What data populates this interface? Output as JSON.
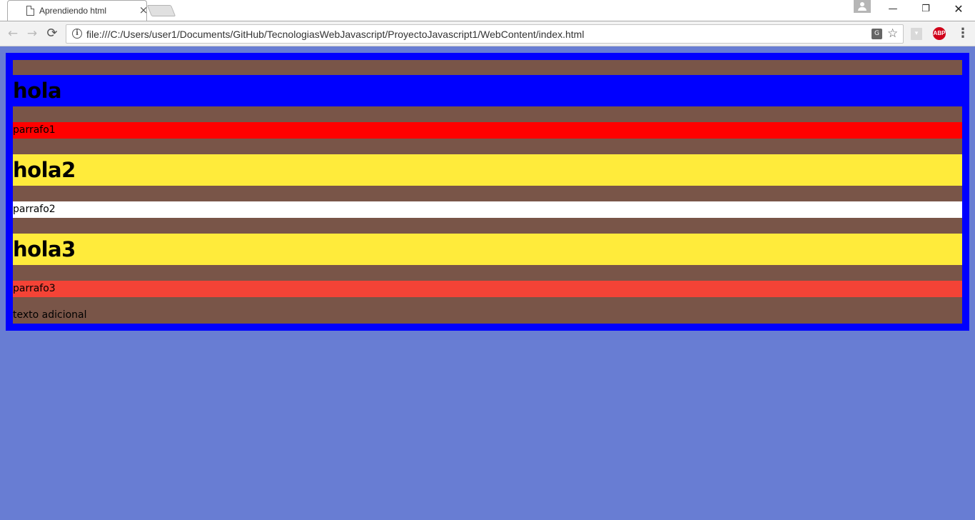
{
  "browser": {
    "tab_title": "Aprendiendo html",
    "tab_close": "×",
    "url": "file:///C:/Users/user1/Documents/GitHub/TecnologiasWebJavascript/ProyectoJavascript1/WebContent/index.html",
    "icons": {
      "back": "arrow-left-icon",
      "forward": "arrow-right-icon",
      "reload": "reload-icon",
      "info": "info-icon",
      "translate": "translate-icon",
      "bookmark": "star-icon",
      "pdf": "pdf-extension-icon",
      "adblock": "adblock-plus-icon",
      "menu": "kebab-menu-icon"
    },
    "adblock_label": "ABP",
    "window_controls": {
      "minimize": "—",
      "maximize": "❐",
      "close": "✕"
    }
  },
  "page": {
    "colors": {
      "body_background": "#687dd3",
      "outer_border": "#0000ff",
      "inner_background": "#795548",
      "heading1_background": "#0000ff",
      "paragraph1_background": "#ff0000",
      "heading2_background": "#ffeb3b",
      "paragraph2_background": "#ffffff",
      "heading3_background": "#ffeb3b",
      "paragraph3_background": "#f44336"
    },
    "heading1": "hola",
    "paragraph1": "parrafo1",
    "heading2": "hola2",
    "paragraph2": "parrafo2",
    "heading3": "hola3",
    "paragraph3": "parrafo3",
    "extra_text": "texto adicional"
  }
}
